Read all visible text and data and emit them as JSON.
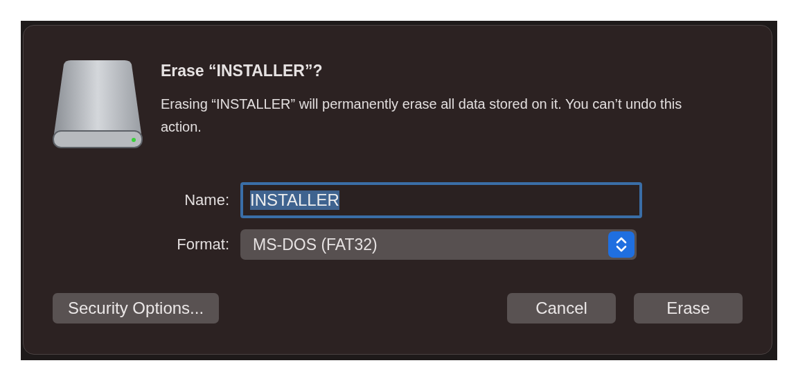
{
  "dialog": {
    "title": "Erase “INSTALLER”?",
    "message": "Erasing “INSTALLER” will permanently erase all data stored on it. You can’t undo this action.",
    "fields": [
      {
        "kind": "text",
        "label": "Name:",
        "value": "INSTALLER",
        "focused": true,
        "text_selected": true
      },
      {
        "kind": "popup",
        "label": "Format:",
        "value": "MS-DOS (FAT32)"
      }
    ],
    "left_buttons": [
      {
        "label": "Security Options..."
      }
    ],
    "right_buttons": [
      {
        "label": "Cancel"
      },
      {
        "label": "Erase"
      }
    ]
  }
}
